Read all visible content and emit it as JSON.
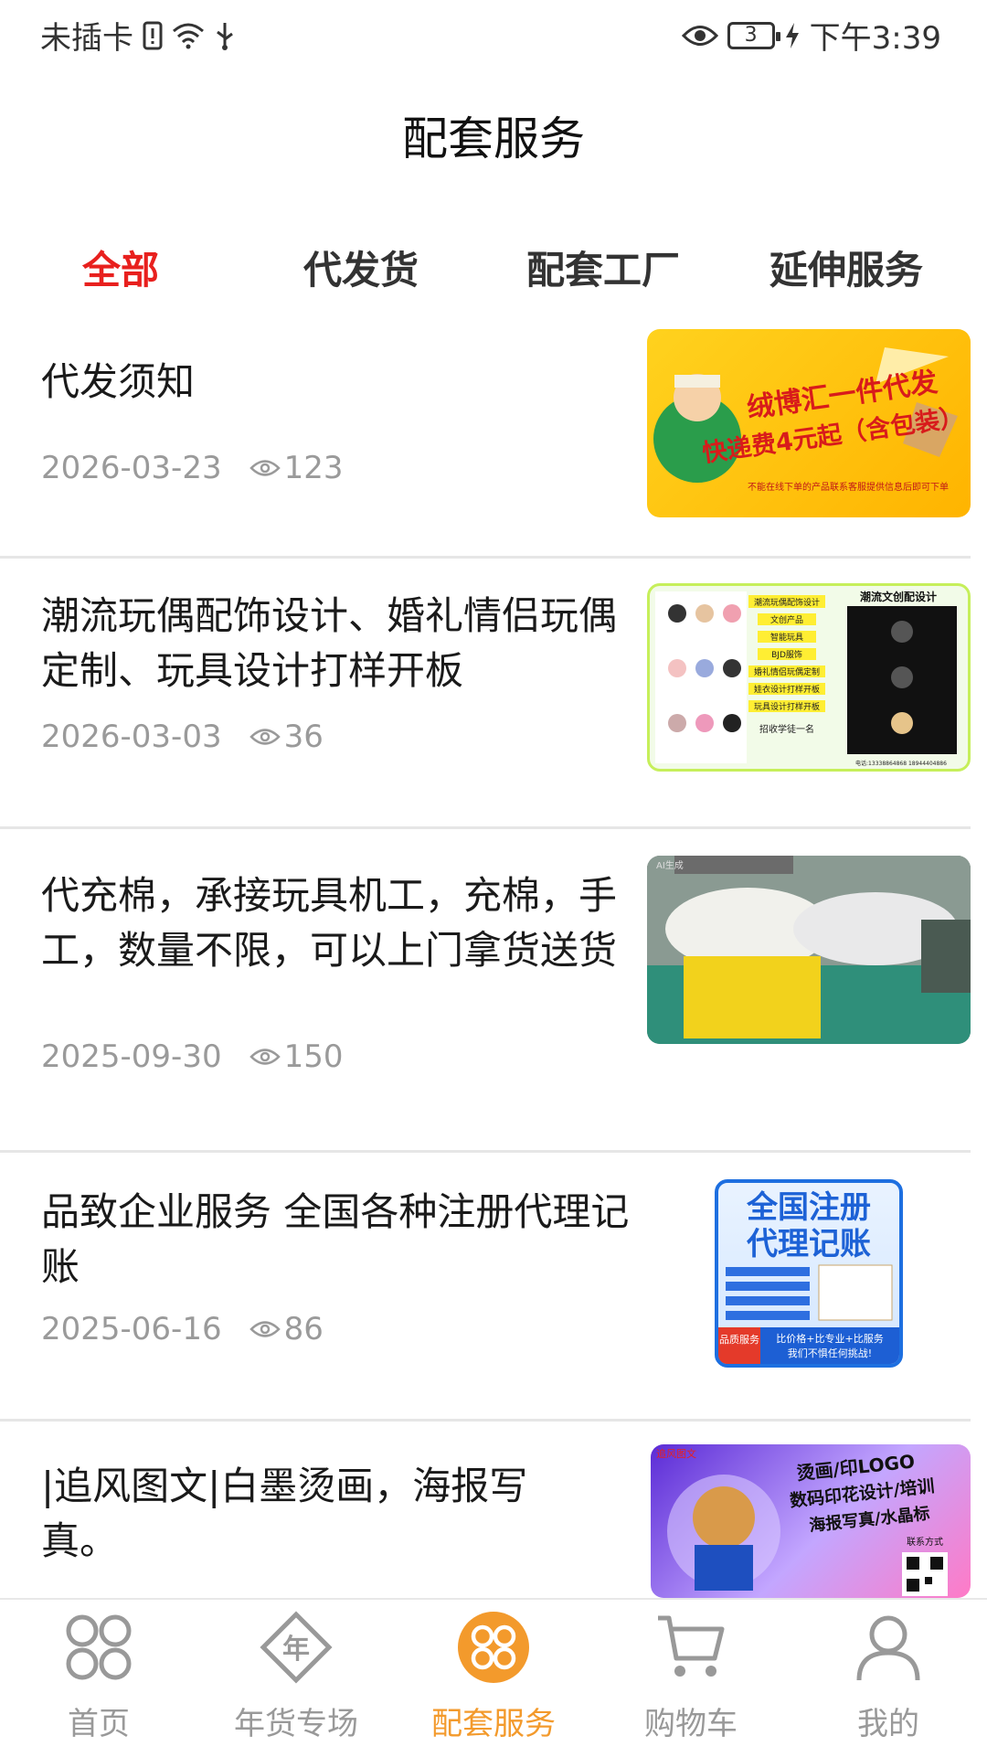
{
  "status_bar": {
    "carrier": "未插卡",
    "battery": "3",
    "time": "下午3:39"
  },
  "header": {
    "title": "配套服务"
  },
  "tabs": [
    {
      "label": "全部",
      "active": true
    },
    {
      "label": "代发货",
      "active": false
    },
    {
      "label": "配套工厂",
      "active": false
    },
    {
      "label": "延伸服务",
      "active": false
    }
  ],
  "items": [
    {
      "title": "代发须知",
      "date": "2026-03-23",
      "views": "123",
      "thumb": {
        "lines": [
          "绒博汇一件代发",
          "快递费4元起（含包装）",
          "不能在线下单的产品联系客服提供信息后即可下单"
        ]
      }
    },
    {
      "title": "潮流玩偶配饰设计、婚礼情侣玩偶定制、玩具设计打样开板",
      "date": "2026-03-03",
      "views": "36",
      "thumb": {
        "lines": [
          "潮流文创配设计",
          "潮流玩偶配饰设计",
          "文创产品",
          "智能玩具",
          "BJD服饰",
          "婚礼情侣玩偶定制",
          "娃衣设计打样开板",
          "玩具设计打样开板",
          "招收学徒一名",
          "电话:13338864868 18944404886"
        ]
      }
    },
    {
      "title": "代充棉，承接玩具机工，充棉，手工，数量不限，可以上门拿货送货",
      "date": "2025-09-30",
      "views": "150",
      "thumb": {
        "lines": [
          "AI生成"
        ]
      }
    },
    {
      "title": "品致企业服务 全国各种注册代理记账",
      "date": "2025-06-16",
      "views": "86",
      "thumb": {
        "lines": [
          "全国注册",
          "代理记账",
          "品质服务",
          "比价格+比专业+比服务",
          "我们不惧任何挑战!"
        ]
      }
    },
    {
      "title": "|追风图文|白墨烫画，海报写真。",
      "date": "",
      "views": "",
      "thumb": {
        "lines": [
          "追风图文",
          "烫画/印LOGO",
          "数码印花设计/培训",
          "海报写真/水晶标",
          "联系方式"
        ]
      }
    }
  ],
  "bottom_nav": [
    {
      "label": "首页",
      "icon": "home-icon",
      "active": false
    },
    {
      "label": "年货专场",
      "icon": "new-year-icon",
      "active": false
    },
    {
      "label": "配套服务",
      "icon": "service-icon",
      "active": true
    },
    {
      "label": "购物车",
      "icon": "cart-icon",
      "active": false
    },
    {
      "label": "我的",
      "icon": "profile-icon",
      "active": false
    }
  ],
  "colors": {
    "accent_red": "#e8201e",
    "active_orange": "#f39a2c",
    "meta_gray": "#9a9a9a"
  }
}
